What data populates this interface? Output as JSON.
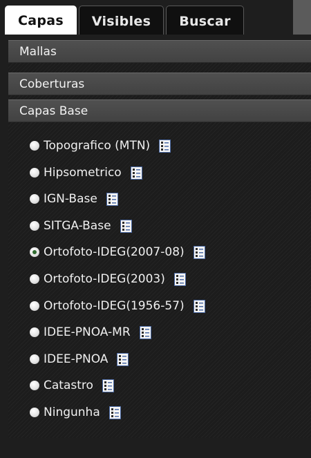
{
  "tabs": [
    {
      "label": "Capas",
      "active": true
    },
    {
      "label": "Visibles",
      "active": false
    },
    {
      "label": "Buscar",
      "active": false
    }
  ],
  "sections": [
    {
      "label": "Mallas"
    },
    {
      "label": "Coberturas"
    },
    {
      "label": "Capas Base"
    }
  ],
  "layers": [
    {
      "label": "Topografico (MTN)",
      "checked": false,
      "icon": "legend-icon"
    },
    {
      "label": "Hipsometrico",
      "checked": false,
      "icon": "legend-icon"
    },
    {
      "label": "IGN-Base",
      "checked": false,
      "icon": "legend-icon"
    },
    {
      "label": "SITGA-Base",
      "checked": false,
      "icon": "legend-icon"
    },
    {
      "label": "Ortofoto-IDEG(2007-08)",
      "checked": true,
      "icon": "legend-icon"
    },
    {
      "label": "Ortofoto-IDEG(2003)",
      "checked": false,
      "icon": "legend-icon"
    },
    {
      "label": "Ortofoto-IDEG(1956-57)",
      "checked": false,
      "icon": "legend-icon"
    },
    {
      "label": "IDEE-PNOA-MR",
      "checked": false,
      "icon": "legend-icon"
    },
    {
      "label": "IDEE-PNOA",
      "checked": false,
      "icon": "legend-icon"
    },
    {
      "label": "Catastro",
      "checked": false,
      "icon": "legend-icon"
    },
    {
      "label": "Ningunha",
      "checked": false,
      "icon": "legend-icon"
    }
  ],
  "colors": {
    "background": "#1e1e1e",
    "section_header": "#4a4a4a",
    "active_tab": "#ffffff",
    "radio_checked_dot": "#2f6b2f",
    "legend_icon_border": "#4b6aa5"
  }
}
